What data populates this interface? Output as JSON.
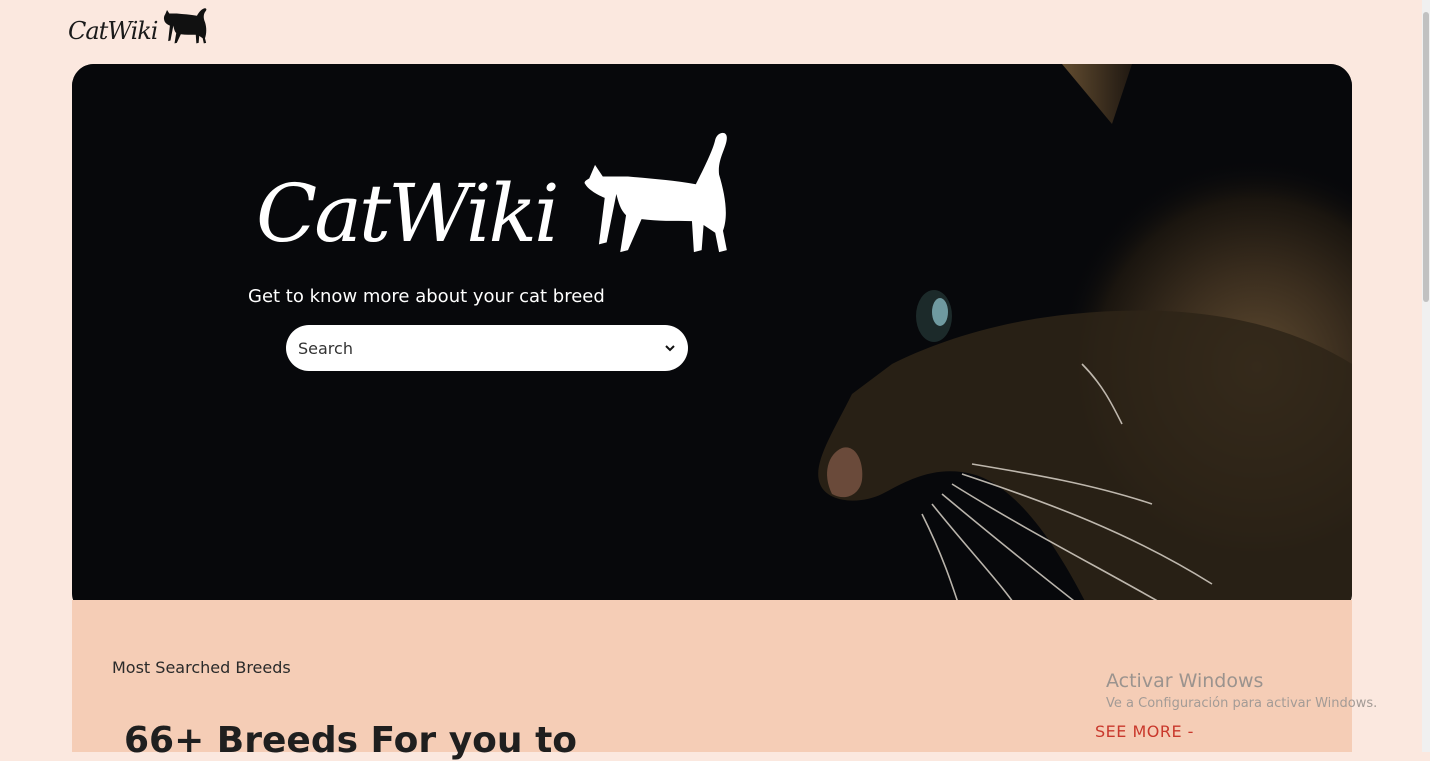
{
  "header": {
    "logo_text": "CatWiki",
    "logo_icon": "cat-silhouette-icon"
  },
  "hero": {
    "title": "CatWiki",
    "title_icon": "cat-silhouette-icon",
    "tagline": "Get to know more about your cat breed",
    "search": {
      "value": "Search",
      "icon": "chevron-down-icon"
    }
  },
  "section": {
    "label": "Most Searched Breeds",
    "heading": "66+ Breeds For you to",
    "see_more": "SEE MORE -"
  },
  "watermark": {
    "title": "Activar Windows",
    "subtitle": "Ve a Configuración para activar Windows."
  },
  "colors": {
    "page_bg": "#fbe8df",
    "hero_bg": "#07080b",
    "section_bg": "#f5cdb6",
    "accent": "#c9382c"
  }
}
